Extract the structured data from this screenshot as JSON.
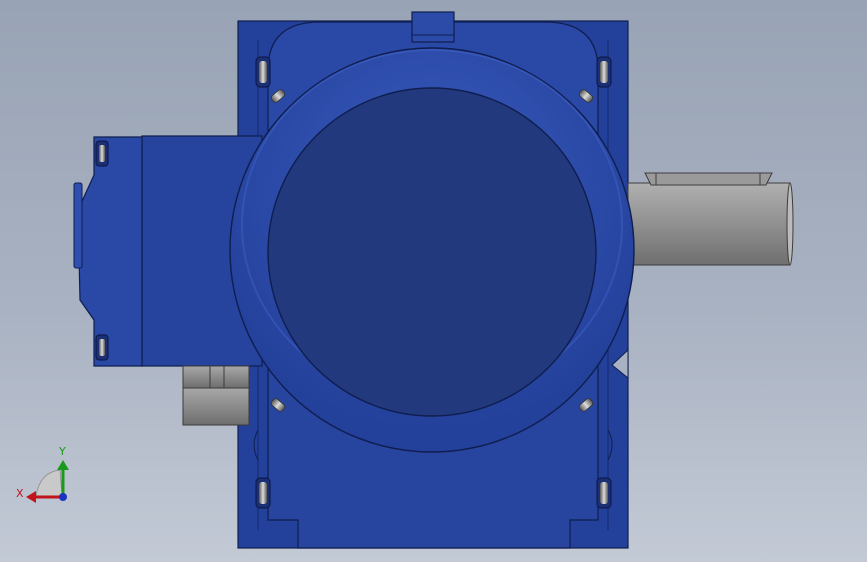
{
  "viewport": {
    "background_top": "#98a3b5",
    "background_bottom": "#c3cad6"
  },
  "model": {
    "body_color": "#25409a",
    "shaft_color": "#8c8c8c"
  },
  "triad": {
    "x_label": "X",
    "y_label": "Y",
    "x_color": "#c0141c",
    "y_color": "#1a9a1a",
    "z_color": "#1a33c0"
  }
}
